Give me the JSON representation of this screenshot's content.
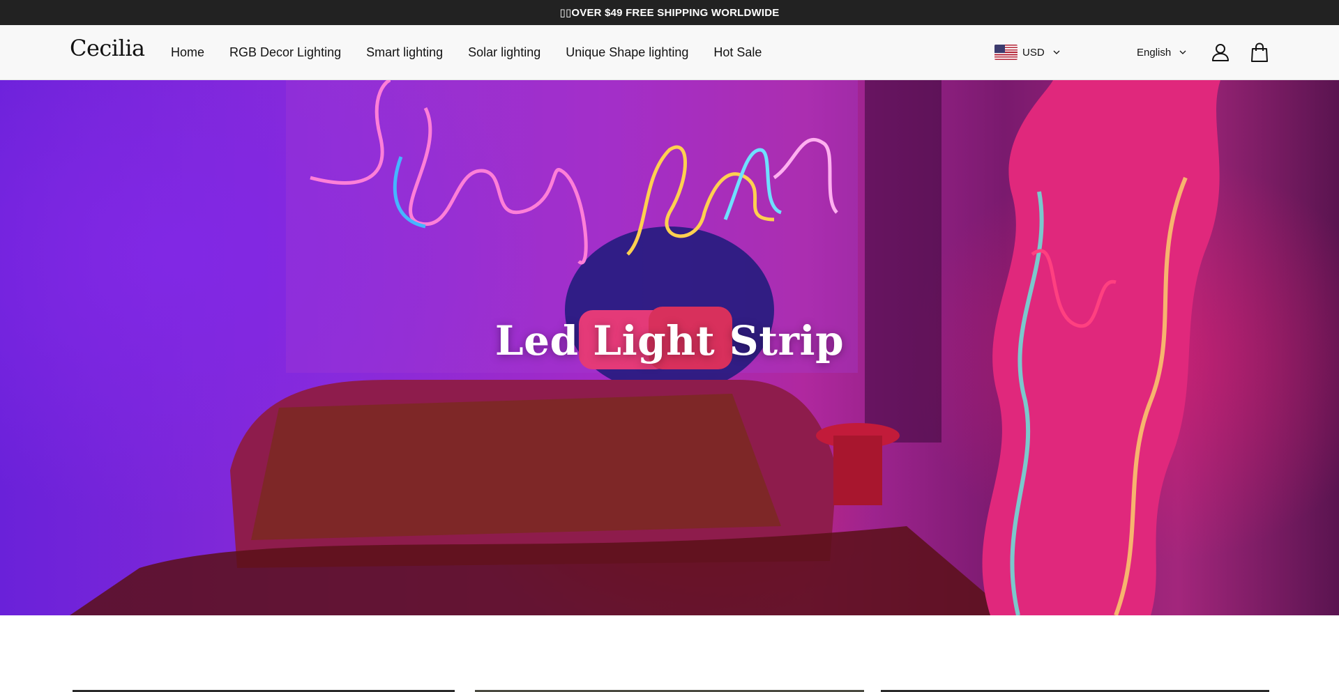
{
  "announcement": {
    "text": "▯▯OVER $49 FREE SHIPPING WORLDWIDE"
  },
  "header": {
    "logo": "Cecilia",
    "nav": [
      {
        "label": "Home"
      },
      {
        "label": "RGB Decor Lighting"
      },
      {
        "label": "Smart lighting"
      },
      {
        "label": "Solar lighting"
      },
      {
        "label": "Unique Shape lighting"
      },
      {
        "label": "Hot Sale"
      }
    ],
    "currency": {
      "code": "USD",
      "flag_icon": "us-flag-icon"
    },
    "language": {
      "label": "English"
    },
    "icons": {
      "account": "account-icon",
      "cart": "cart-icon"
    }
  },
  "hero": {
    "title": "Led Light Strip"
  },
  "colors": {
    "announcement_bg": "#222222",
    "header_bg": "#f8f8f8",
    "text": "#121212",
    "hero_title": "#ffffff"
  }
}
